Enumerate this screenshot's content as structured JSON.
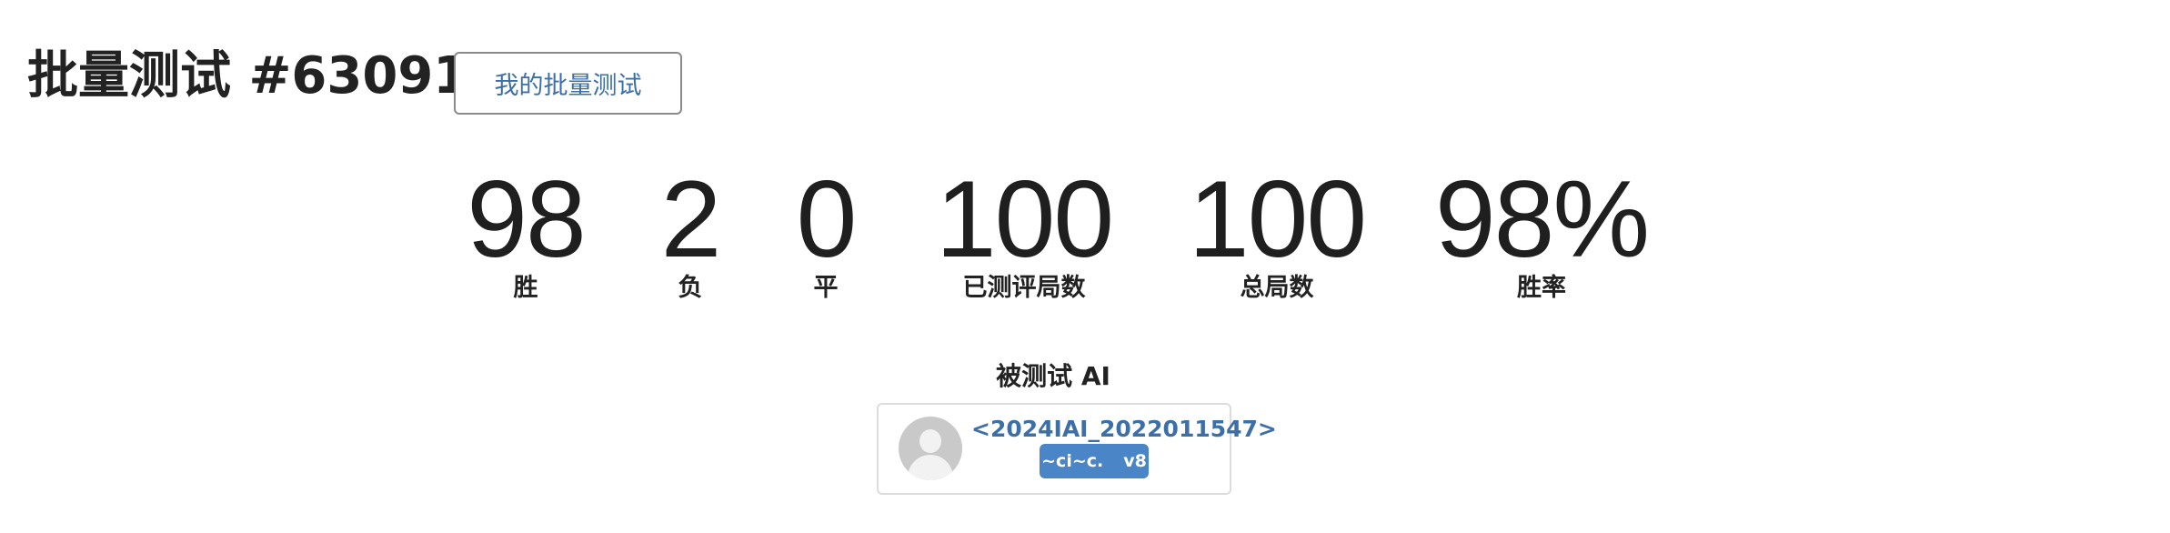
{
  "header": {
    "title": "批量测试 #63091",
    "my_batch_button": "我的批量测试"
  },
  "stats": [
    {
      "value": "98",
      "label": "胜"
    },
    {
      "value": "2",
      "label": "负"
    },
    {
      "value": "0",
      "label": "平"
    },
    {
      "value": "100",
      "label": "已测评局数"
    },
    {
      "value": "100",
      "label": "总局数"
    },
    {
      "value": "98%",
      "label": "胜率"
    }
  ],
  "tested_ai": {
    "section_label": "被测试 AI",
    "name": "<2024IAI_2022011547>",
    "badge_code": "~ci~c.",
    "badge_version": "v8",
    "avatar_icon": "user-avatar-placeholder-icon"
  },
  "colors": {
    "link": "#3c6fa8",
    "badge_bg": "#4a86c7",
    "text": "#222222"
  }
}
